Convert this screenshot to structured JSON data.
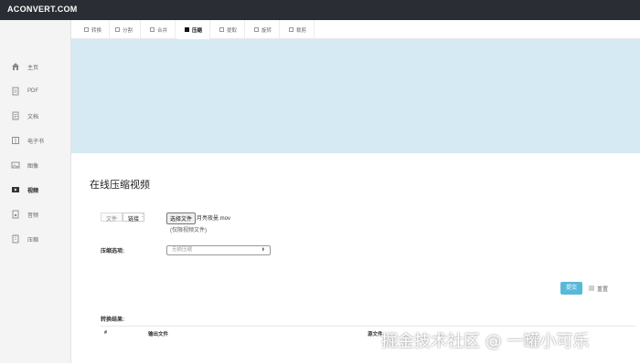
{
  "header": {
    "logo": "ACONVERT.COM"
  },
  "sidebar": {
    "items": [
      {
        "label": "主页",
        "icon": "home-icon"
      },
      {
        "label": "PDF",
        "icon": "pdf-icon"
      },
      {
        "label": "文档",
        "icon": "document-icon"
      },
      {
        "label": "电子书",
        "icon": "ebook-icon"
      },
      {
        "label": "图像",
        "icon": "image-icon"
      },
      {
        "label": "视频",
        "icon": "video-icon",
        "active": true
      },
      {
        "label": "音频",
        "icon": "audio-icon"
      },
      {
        "label": "压缩",
        "icon": "archive-icon"
      }
    ]
  },
  "tabs": [
    {
      "label": "转换"
    },
    {
      "label": "分割"
    },
    {
      "label": "合并"
    },
    {
      "label": "压缩",
      "active": true
    },
    {
      "label": "提取"
    },
    {
      "label": "旋转"
    },
    {
      "label": "裁剪"
    }
  ],
  "main": {
    "title": "在线压缩视频",
    "source_tabs": [
      {
        "label": "文件"
      },
      {
        "label": "链接",
        "active": true
      }
    ],
    "colon": ":",
    "file_button": "选择文件",
    "file_name": "月亮夜曼.mov",
    "file_note": "(仅限视频文件)",
    "option_label": "压缩选项:",
    "option_selected": "无损压缩",
    "submit_label": "提交",
    "reset_label": "重置",
    "result_label": "转换结果:",
    "result_headers": [
      "#",
      "输出文件",
      "源文件"
    ]
  },
  "watermark": "掘金技术社区 @ 一罐小可乐",
  "colors": {
    "topbar": "#2a2d33",
    "banner": "#d5eaf2",
    "submit": "#58b8d8"
  }
}
